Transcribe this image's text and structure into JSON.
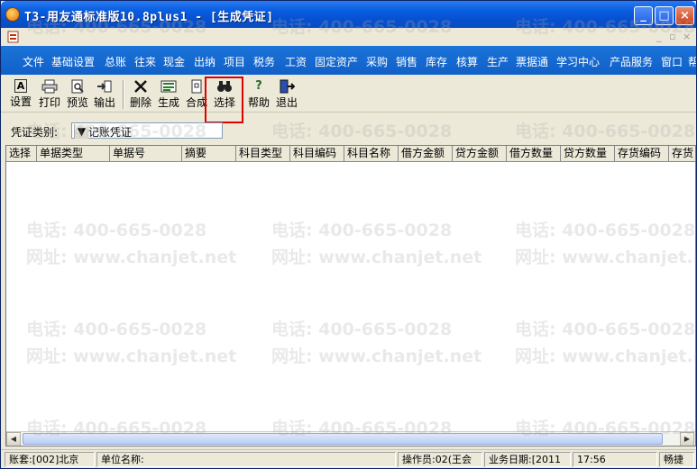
{
  "window": {
    "title": "T3-用友通标准版10.8plus1 - [生成凭证]",
    "minimize": "_",
    "maximize": "□",
    "close": "×"
  },
  "mdi_controls": [
    "_",
    "▫",
    "×"
  ],
  "menu": [
    "文件",
    "基础设置",
    "总账",
    "往来",
    "现金",
    "出纳",
    "项目",
    "税务",
    "工资",
    "固定资产",
    "采购",
    "销售",
    "库存",
    "核算",
    "生产",
    "票据通",
    "学习中心",
    "产品服务",
    "窗口",
    "帮"
  ],
  "toolbar": {
    "setup": "设置",
    "print": "打印",
    "preview": "预览",
    "export": "输出",
    "delete": "删除",
    "generate": "生成",
    "merge": "合成",
    "select": "选择",
    "help": "帮助",
    "exit": "退出"
  },
  "voucher": {
    "label": "凭证类别:",
    "value": "记 记账凭证"
  },
  "grid": {
    "columns": [
      "选择",
      "单据类型",
      "单据号",
      "摘要",
      "科目类型",
      "科目编码",
      "科目名称",
      "借方金额",
      "贷方金额",
      "借方数量",
      "贷方数量",
      "存货编码",
      "存货"
    ]
  },
  "watermark": {
    "phone": "电话: 400-665-0028",
    "site": "网址: www.chanjet.net"
  },
  "status": {
    "account": "账套:[002]北京",
    "unit": "单位名称:",
    "operator": "操作员:02(王会",
    "date": "业务日期:[2011",
    "time": "17:56",
    "mode": "畅捷"
  }
}
